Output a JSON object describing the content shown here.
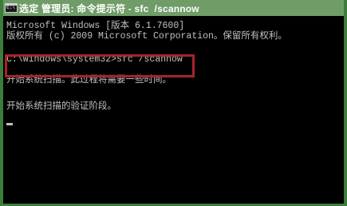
{
  "window": {
    "title": "选定 管理员: 命令提示符 - sfc  /scannow",
    "icon": "cmd-icon"
  },
  "console": {
    "lines": [
      "Microsoft Windows [版本 6.1.7600]",
      "版权所有 (c) 2009 Microsoft Corporation。保留所有权利。",
      "C:\\Windows\\system32>sfc /scannow",
      "开始系统扫描。此过程将需要一些时间。",
      "开始系统扫描的验证阶段。"
    ]
  },
  "colors": {
    "titlebar": "#6f9c67",
    "frame": "#3b7d3b",
    "console_bg": "#000000",
    "console_text": "#c0c0c0",
    "highlight": "#a8232b"
  }
}
